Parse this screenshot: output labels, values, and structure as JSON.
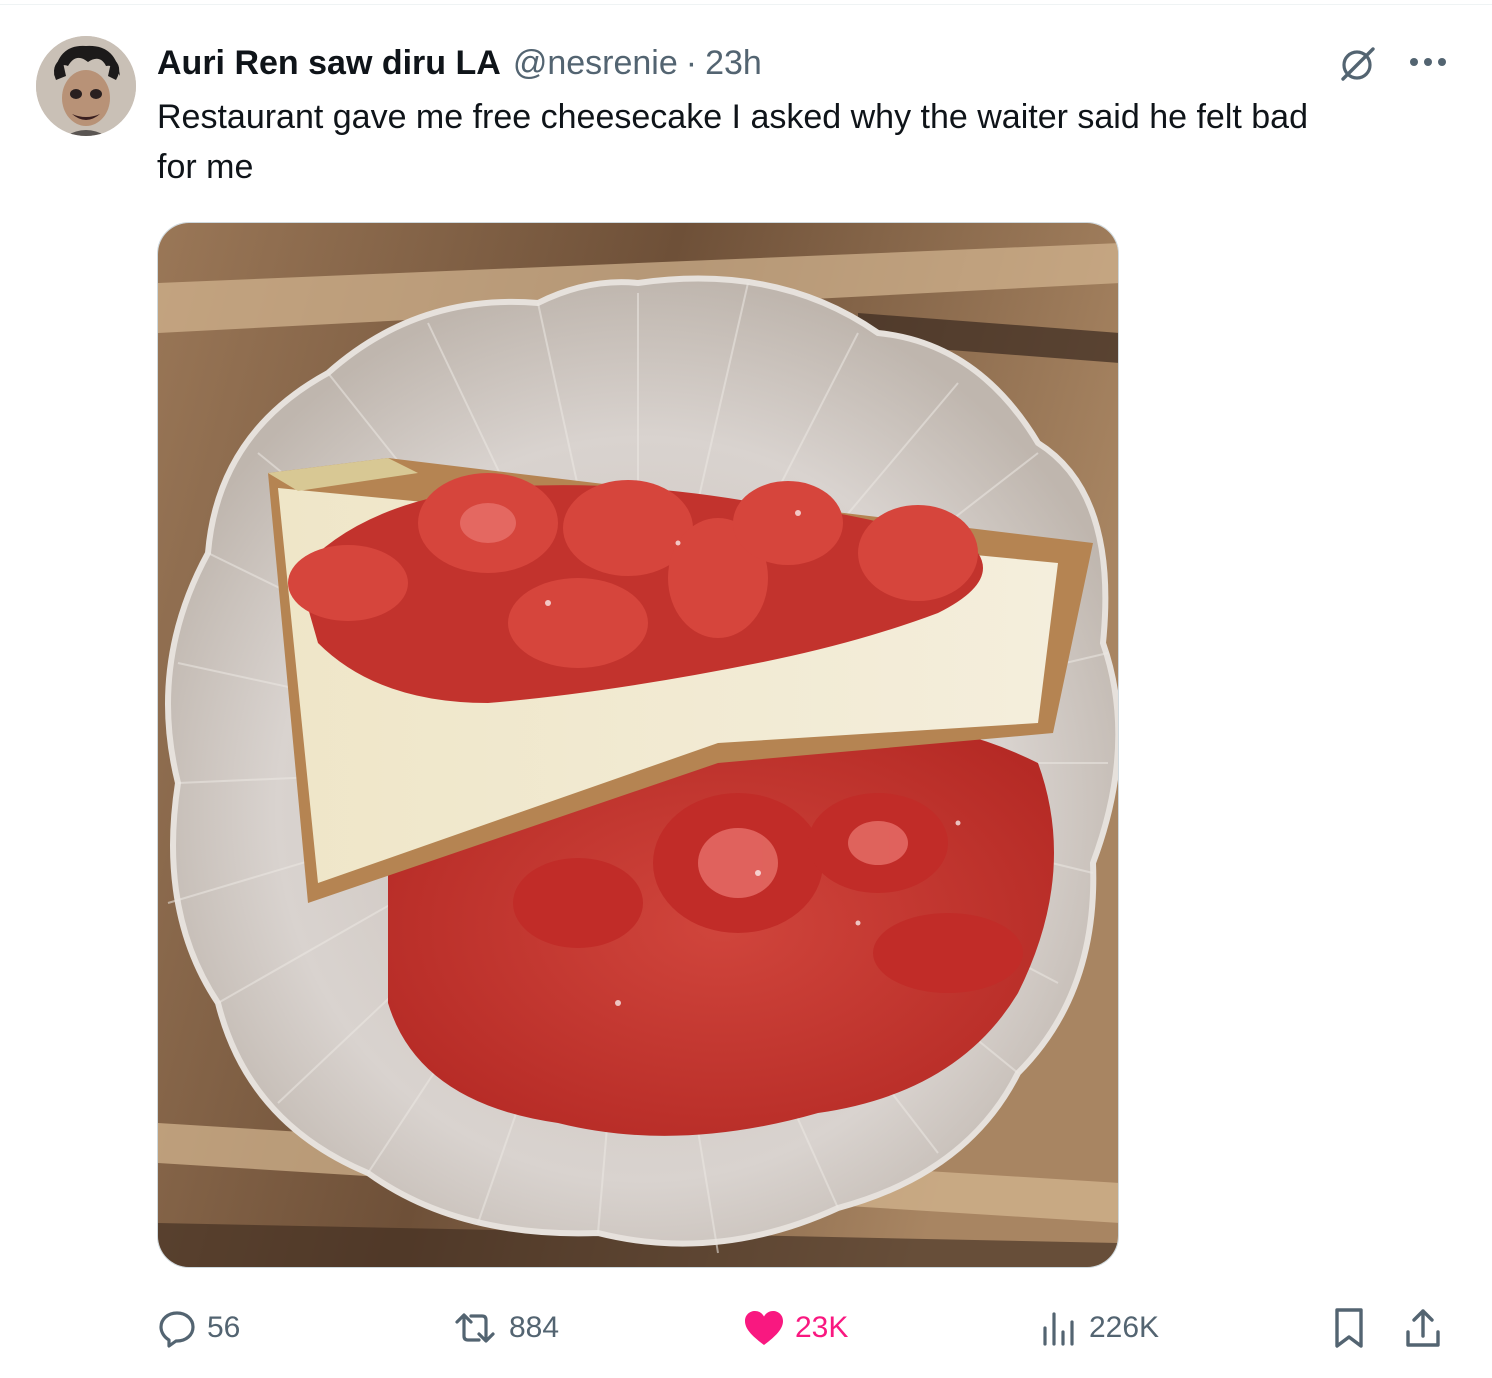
{
  "tweet": {
    "author": {
      "display_name": "Auri Ren saw diru LA",
      "handle": "@nesrenie",
      "separator": "·",
      "time": "23h"
    },
    "text": "Restaurant gave me free cheesecake I asked why the waiter said he felt bad\nfor me",
    "actions": {
      "replies": "56",
      "reposts": "884",
      "likes": "23K",
      "views": "226K"
    },
    "liked": true
  },
  "colors": {
    "text_primary": "#0f1419",
    "text_secondary": "#536471",
    "like_pink": "#f91880",
    "border": "#cfd9de"
  },
  "icons": [
    "grok-icon",
    "more-icon",
    "reply-icon",
    "repost-icon",
    "like-heart-icon",
    "views-icon",
    "bookmark-icon",
    "share-icon"
  ]
}
